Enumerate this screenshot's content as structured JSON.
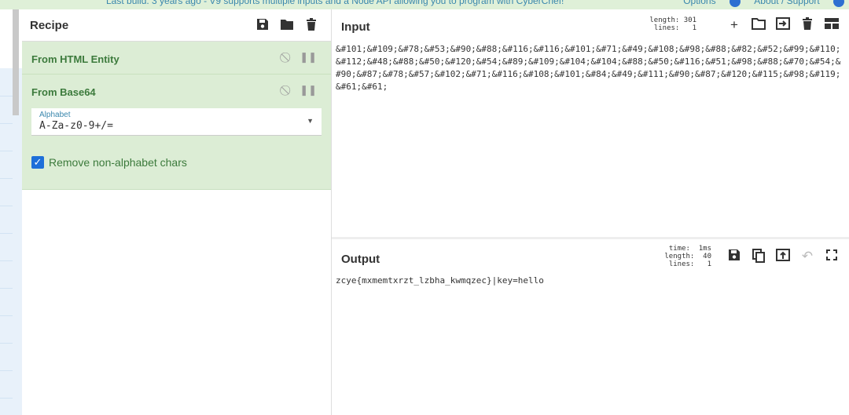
{
  "banner": {
    "message_prefix": "Last build: 3 years ago - V9 supports",
    "message_link": "multiple inputs",
    "message_suffix": "and a Node API allowing you to program with CyberChef!",
    "options": "Options",
    "about": "About / Support"
  },
  "recipe": {
    "title": "Recipe",
    "operations": [
      {
        "name": "From HTML Entity"
      },
      {
        "name": "From Base64",
        "alphabet_label": "Alphabet",
        "alphabet_value": "A-Za-z0-9+/=",
        "remove_label": "Remove non-alphabet chars",
        "remove_checked": true
      }
    ]
  },
  "input": {
    "title": "Input",
    "length_line": "length: 301",
    "lines_line": "lines:   1",
    "text": "&#101;&#109;&#78;&#53;&#90;&#88;&#116;&#116;&#101;&#71;&#49;&#108;&#98;&#88;&#82;&#52;&#99;&#110;&#112;&#48;&#88;&#50;&#120;&#54;&#89;&#109;&#104;&#104;&#88;&#50;&#116;&#51;&#98;&#88;&#70;&#54;&#90;&#87;&#78;&#57;&#102;&#71;&#116;&#108;&#101;&#84;&#49;&#111;&#90;&#87;&#120;&#115;&#98;&#119;&#61;&#61;"
  },
  "output": {
    "title": "Output",
    "time_line": "time:  1ms",
    "length_line": "length:  40",
    "lines_line": "lines:   1",
    "text": "zcye{mxmemtxrzt_lzbha_kwmqzec}|key=hello"
  },
  "colors": {
    "accent": "#1e6fd9",
    "op_bg": "#dcedd5",
    "op_text": "#3c7a3c",
    "banner_bg": "#dff0d8"
  }
}
